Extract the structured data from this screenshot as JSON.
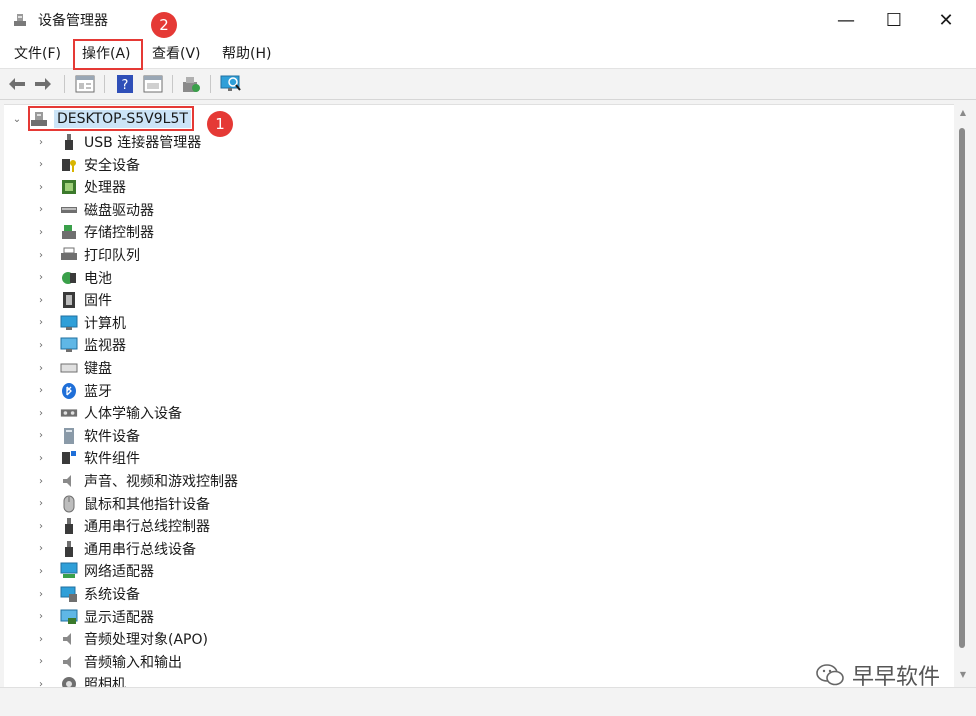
{
  "window": {
    "title": "设备管理器",
    "minimize": "—",
    "maximize": "☐",
    "close": "✕"
  },
  "menu": [
    {
      "label": "文件(F)"
    },
    {
      "label": "操作(A)"
    },
    {
      "label": "查看(V)"
    },
    {
      "label": "帮助(H)"
    }
  ],
  "toolbar": {
    "icons": [
      "back-icon",
      "forward-icon",
      "properties-icon",
      "help-icon",
      "show-hidden-icon",
      "update-driver-icon",
      "scan-hardware-icon"
    ]
  },
  "tree": {
    "root": "DESKTOP-S5V9L5T",
    "items": [
      {
        "label": "USB 连接器管理器",
        "icon": "usb-connector-icon"
      },
      {
        "label": "安全设备",
        "icon": "security-device-icon"
      },
      {
        "label": "处理器",
        "icon": "processor-icon"
      },
      {
        "label": "磁盘驱动器",
        "icon": "disk-drive-icon"
      },
      {
        "label": "存储控制器",
        "icon": "storage-controller-icon"
      },
      {
        "label": "打印队列",
        "icon": "print-queue-icon"
      },
      {
        "label": "电池",
        "icon": "battery-icon"
      },
      {
        "label": "固件",
        "icon": "firmware-icon"
      },
      {
        "label": "计算机",
        "icon": "computer-icon"
      },
      {
        "label": "监视器",
        "icon": "monitor-icon"
      },
      {
        "label": "键盘",
        "icon": "keyboard-icon"
      },
      {
        "label": "蓝牙",
        "icon": "bluetooth-icon"
      },
      {
        "label": "人体学输入设备",
        "icon": "hid-icon"
      },
      {
        "label": "软件设备",
        "icon": "software-device-icon"
      },
      {
        "label": "软件组件",
        "icon": "software-component-icon"
      },
      {
        "label": "声音、视频和游戏控制器",
        "icon": "sound-icon"
      },
      {
        "label": "鼠标和其他指针设备",
        "icon": "mouse-icon"
      },
      {
        "label": "通用串行总线控制器",
        "icon": "usb-controller-icon"
      },
      {
        "label": "通用串行总线设备",
        "icon": "usb-device-icon"
      },
      {
        "label": "网络适配器",
        "icon": "network-adapter-icon"
      },
      {
        "label": "系统设备",
        "icon": "system-device-icon"
      },
      {
        "label": "显示适配器",
        "icon": "display-adapter-icon"
      },
      {
        "label": "音频处理对象(APO)",
        "icon": "audio-processing-icon"
      },
      {
        "label": "音频输入和输出",
        "icon": "audio-io-icon"
      },
      {
        "label": "照相机",
        "icon": "camera-icon"
      }
    ]
  },
  "annotations": {
    "badge1": "1",
    "badge2": "2"
  },
  "watermark": "早早软件",
  "colors": {
    "annotation_red": "#e53935",
    "selection": "#cce4f7"
  }
}
